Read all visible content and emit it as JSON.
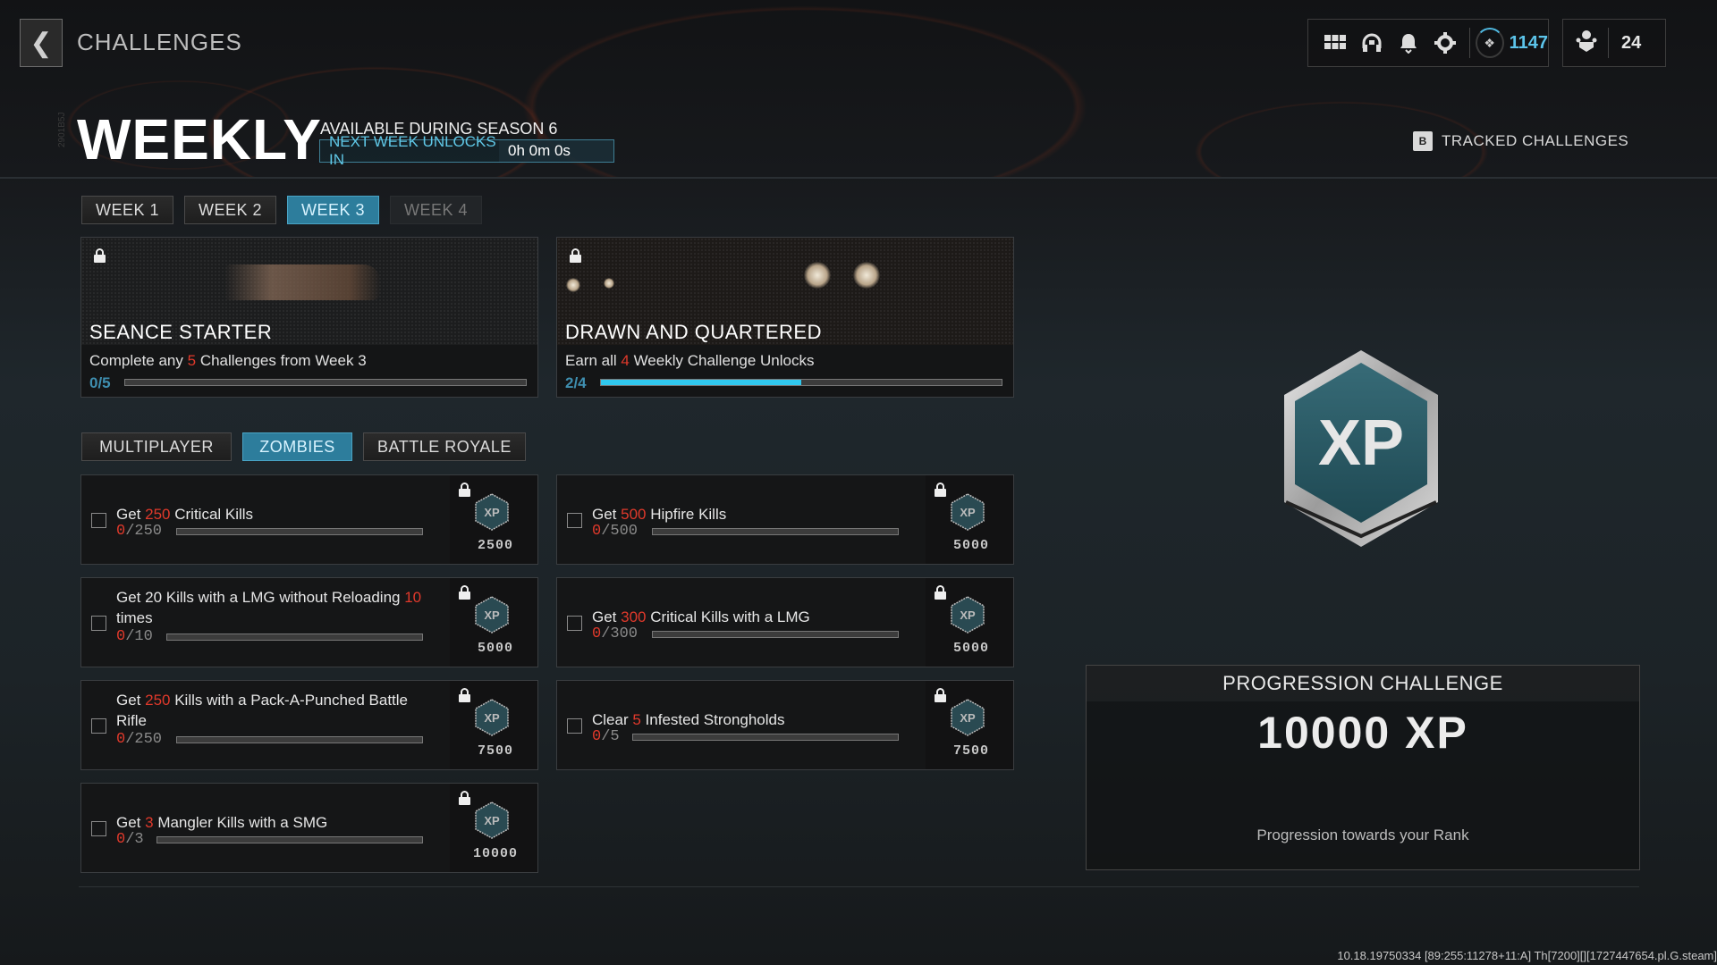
{
  "header": {
    "back_icon": "chevron-left-icon",
    "breadcrumb": "CHALLENGES",
    "title": "WEEKLY",
    "side_code": "2901B5J",
    "availability": "AVAILABLE DURING SEASON 6",
    "unlock_label": "NEXT WEEK UNLOCKS IN",
    "unlock_time": "0h 0m 0s"
  },
  "topbar": {
    "icons": [
      "grid-menu-icon",
      "headset-icon",
      "bell-icon",
      "gear-icon"
    ],
    "rank_icon": "rank-emblem-icon",
    "rank_value": "1147",
    "players_icon": "party-icon",
    "players_count": "24"
  },
  "tracked": {
    "key": "B",
    "label": "TRACKED CHALLENGES"
  },
  "week_tabs": [
    {
      "label": "WEEK 1",
      "state": "normal"
    },
    {
      "label": "WEEK 2",
      "state": "normal"
    },
    {
      "label": "WEEK 3",
      "state": "active"
    },
    {
      "label": "WEEK 4",
      "state": "disabled"
    }
  ],
  "featured": [
    {
      "title": "SEANCE STARTER",
      "desc_pre": "Complete any ",
      "desc_hl": "5",
      "desc_post": " Challenges from Week 3",
      "progress_text": "0/5",
      "progress": 0.0,
      "locked": true
    },
    {
      "title": "DRAWN AND QUARTERED",
      "desc_pre": "Earn all ",
      "desc_hl": "4",
      "desc_post": " Weekly Challenge Unlocks",
      "progress_text": "2/4",
      "progress": 0.5,
      "locked": true
    }
  ],
  "mode_tabs": [
    {
      "label": "MULTIPLAYER",
      "state": "normal"
    },
    {
      "label": "ZOMBIES",
      "state": "active"
    },
    {
      "label": "BATTLE ROYALE",
      "state": "normal"
    }
  ],
  "challenges": [
    {
      "pre": "Get ",
      "hl": "250",
      "post": " Critical Kills",
      "current": "0",
      "total": "/250",
      "xp": "2500"
    },
    {
      "pre": "Get ",
      "hl": "500",
      "post": " Hipfire Kills",
      "current": "0",
      "total": "/500",
      "xp": "5000"
    },
    {
      "pre": "Get 20 Kills with a LMG without Reloading ",
      "hl": "10",
      "post": " times",
      "current": "0",
      "total": "/10",
      "xp": "5000"
    },
    {
      "pre": "Get ",
      "hl": "300",
      "post": " Critical Kills with a LMG",
      "current": "0",
      "total": "/300",
      "xp": "5000"
    },
    {
      "pre": "Get ",
      "hl": "250",
      "post": " Kills with a Pack-A-Punched Battle Rifle",
      "current": "0",
      "total": "/250",
      "xp": "7500"
    },
    {
      "pre": "Clear ",
      "hl": "5",
      "post": " Infested Strongholds",
      "current": "0",
      "total": "/5",
      "xp": "7500"
    },
    {
      "pre": "Get ",
      "hl": "3",
      "post": " Mangler Kills with a SMG",
      "current": "0",
      "total": "/3",
      "xp": "10000"
    }
  ],
  "reward_panel": {
    "badge_text": "XP",
    "heading": "PROGRESSION CHALLENGE",
    "amount": "10000 XP",
    "subtitle": "Progression towards your Rank"
  },
  "build_string": "10.18.19750334 [89:255:11278+11:A] Th[7200][][1727447654.pl.G.steam]",
  "colors": {
    "accent": "#2d7d9c",
    "progress_fill": "#30c8ee",
    "highlight": "#e0392b",
    "rank": "#5cc4ea"
  }
}
